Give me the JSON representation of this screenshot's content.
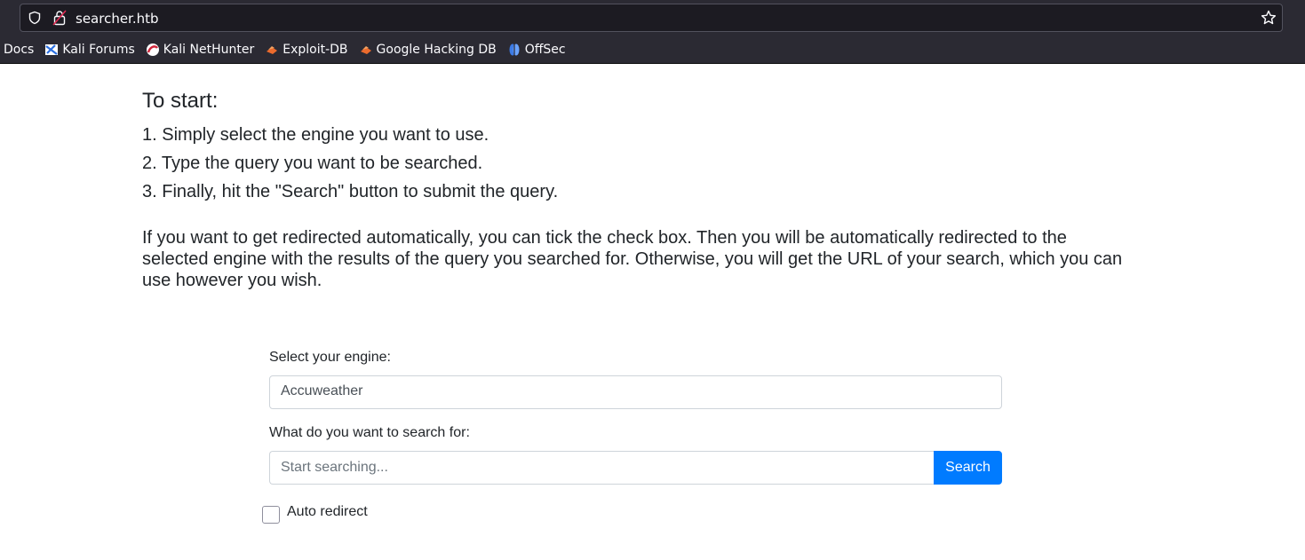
{
  "browser": {
    "url": "searcher.htb",
    "bookmarks": [
      {
        "label": "Docs",
        "icon": "none"
      },
      {
        "label": "Kali Forums",
        "icon": "kali-forums-icon"
      },
      {
        "label": "Kali NetHunter",
        "icon": "nethunter-icon"
      },
      {
        "label": "Exploit-DB",
        "icon": "exploit-db-icon"
      },
      {
        "label": "Google Hacking DB",
        "icon": "ghdb-icon"
      },
      {
        "label": "OffSec",
        "icon": "offsec-icon"
      }
    ]
  },
  "instructions": {
    "heading": "To start:",
    "steps": [
      "1. Simply select the engine you want to use.",
      "2. Type the query you want to be searched.",
      "3. Finally, hit the \"Search\" button to submit the query."
    ],
    "paragraph": "If you want to get redirected automatically, you can tick the check box. Then you will be automatically redirected to the selected engine with the results of the query you searched for. Otherwise, you will get the URL of your search, which you can use however you wish."
  },
  "form": {
    "engine_label": "Select your engine:",
    "engine_value": "Accuweather",
    "query_label": "What do you want to search for:",
    "query_placeholder": "Start searching...",
    "search_button": "Search",
    "auto_redirect_label": "Auto redirect",
    "auto_redirect_checked": false
  },
  "colors": {
    "primary": "#007bff",
    "chrome_bg": "#2b2a33",
    "text": "#212529"
  }
}
